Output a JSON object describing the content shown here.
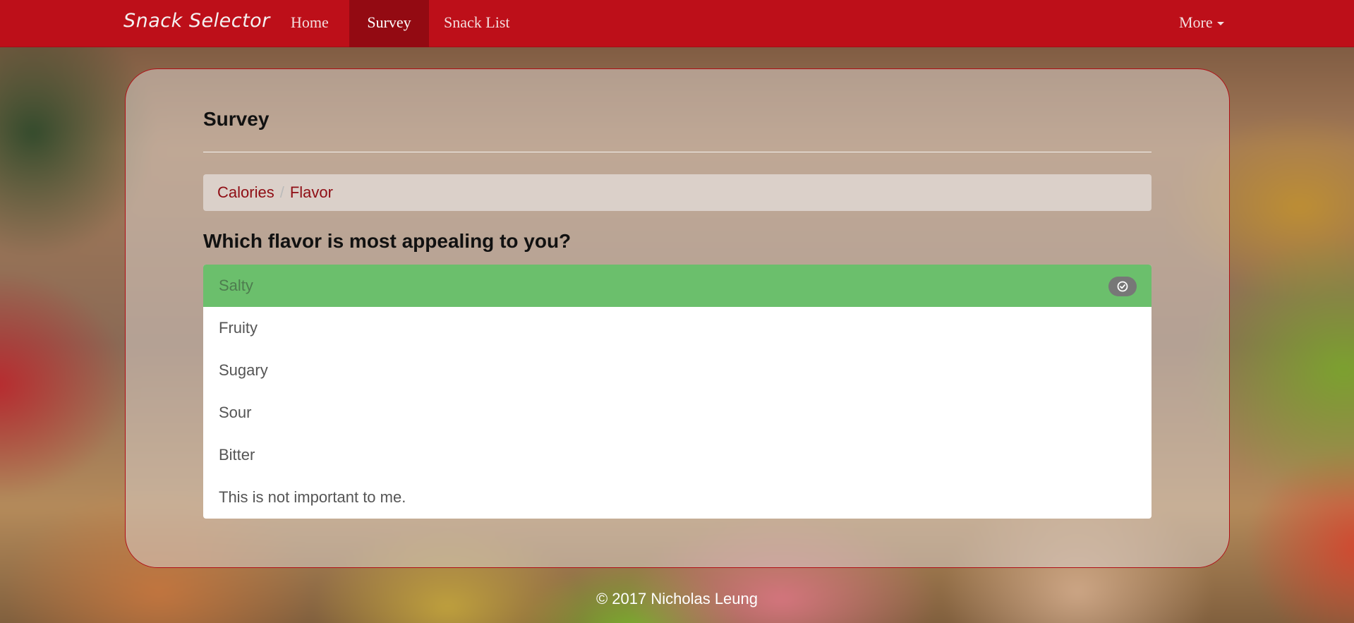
{
  "navbar": {
    "brand": "Snack Selector",
    "items": [
      {
        "label": "Home",
        "active": false
      },
      {
        "label": "Survey",
        "active": true
      },
      {
        "label": "Snack List",
        "active": false
      }
    ],
    "more_label": "More",
    "color": "#bd0f19"
  },
  "main": {
    "title": "Survey",
    "breadcrumb": [
      "Calories",
      "Flavor"
    ],
    "question": "Which flavor is most appealing to you?",
    "options": [
      {
        "label": "Salty",
        "selected": true
      },
      {
        "label": "Fruity",
        "selected": false
      },
      {
        "label": "Sugary",
        "selected": false
      },
      {
        "label": "Sour",
        "selected": false
      },
      {
        "label": "Bitter",
        "selected": false
      },
      {
        "label": "This is not important to me.",
        "selected": false
      }
    ],
    "selected_color": "#6bbf6c",
    "selected_icon": "check-circle-icon"
  },
  "footer": {
    "text": "© 2017 Nicholas Leung"
  }
}
